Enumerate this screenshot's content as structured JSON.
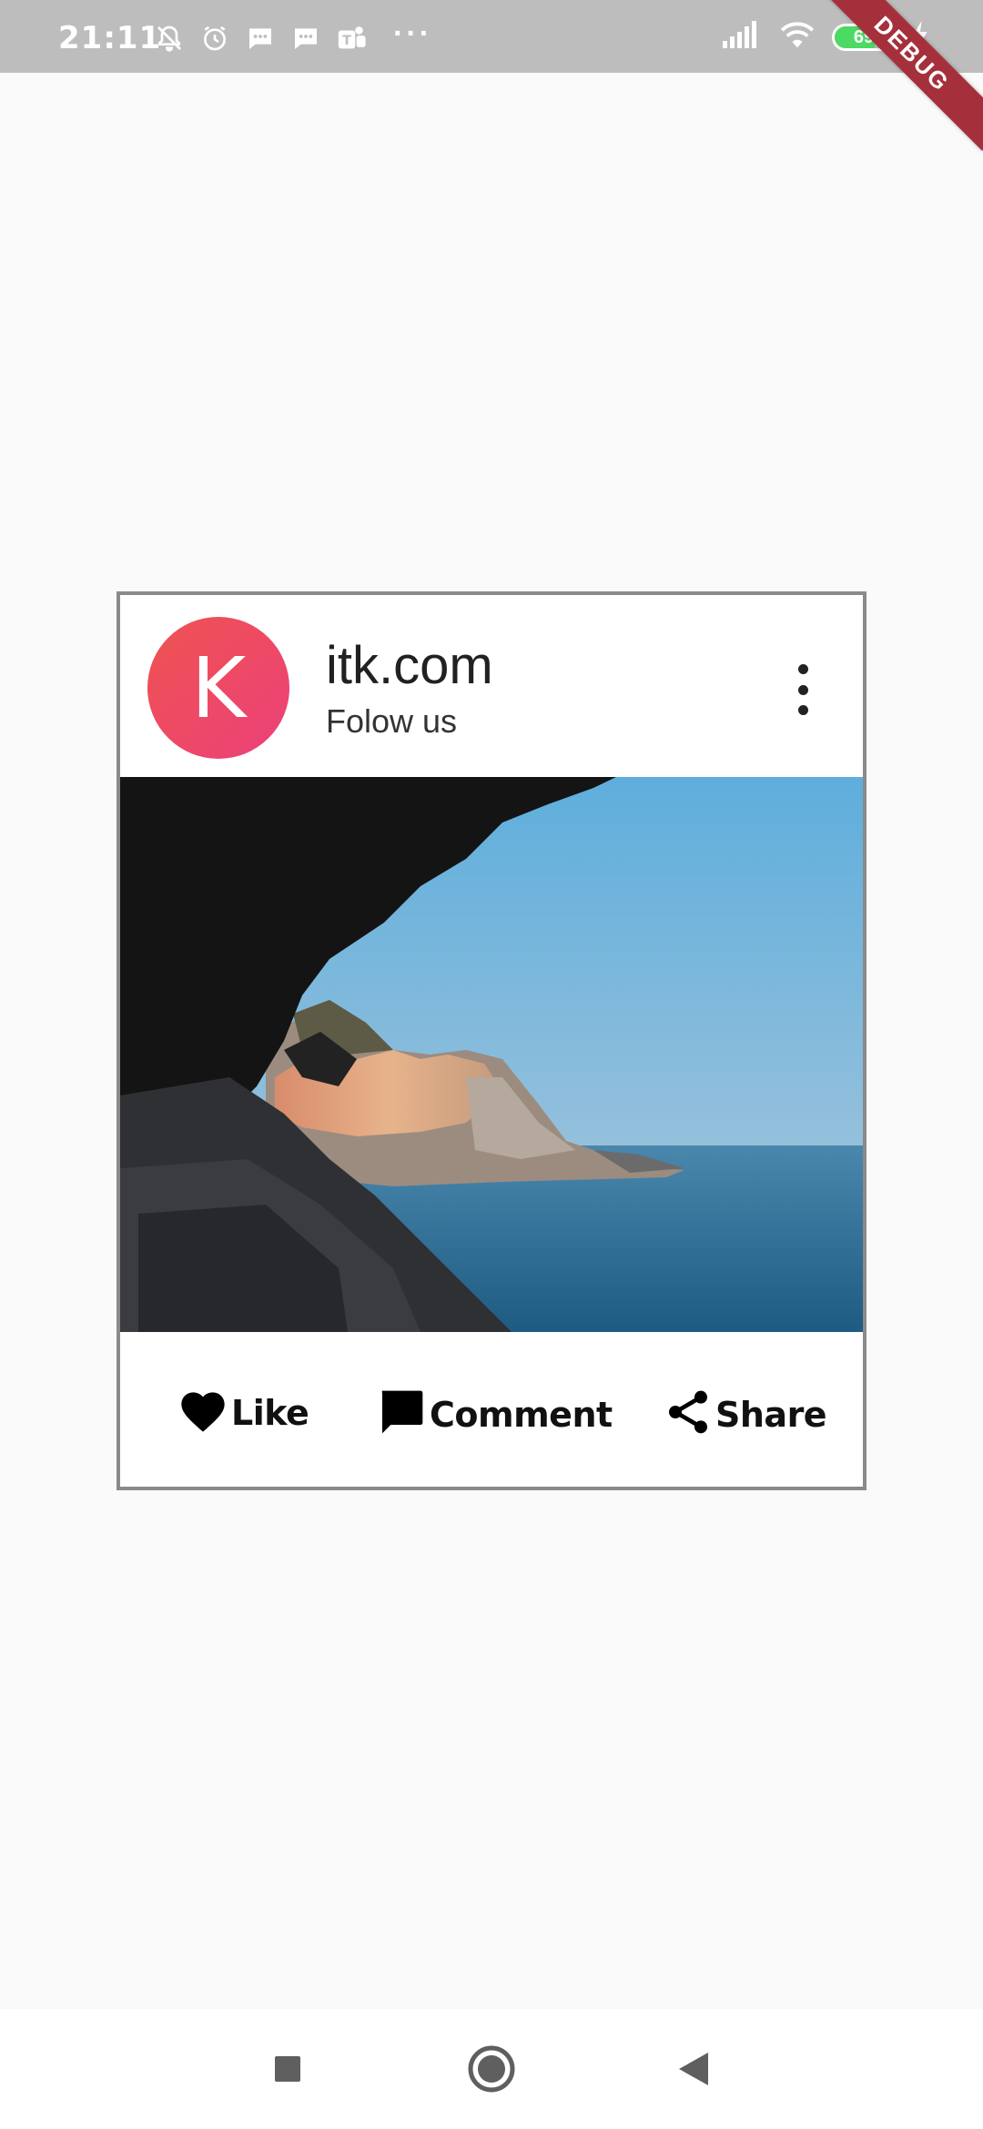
{
  "status_bar": {
    "time": "21:11",
    "dots": "···",
    "battery_level": "69",
    "battery_fraction": 0.69,
    "left_icons": [
      "silent-bell-icon",
      "alarm-icon",
      "message-icon",
      "message-icon",
      "teams-icon"
    ],
    "right_icons": [
      "signal-icon",
      "wifi-icon",
      "battery-icon",
      "charging-icon"
    ]
  },
  "debug_banner": "DEBUG",
  "card": {
    "avatar_letter": "K",
    "title": "itk.com",
    "subtitle": "Folow us",
    "image": "coastal-village-cave-photo",
    "actions": [
      {
        "label": "Like",
        "icon": "heart-icon"
      },
      {
        "label": "Comment",
        "icon": "comment-icon"
      },
      {
        "label": "Share",
        "icon": "share-icon"
      }
    ]
  },
  "navigation": {
    "buttons": [
      "recents-square-icon",
      "home-circle-icon",
      "back-triangle-icon"
    ]
  },
  "colors": {
    "status_bar_bg": "#bdbdbd",
    "avatar_gradient_start": "#ef5350",
    "avatar_gradient_end": "#ec407a",
    "card_border": "#8a8a8a",
    "debug_ribbon": "#a5303b",
    "battery_fill": "#4cd964"
  }
}
